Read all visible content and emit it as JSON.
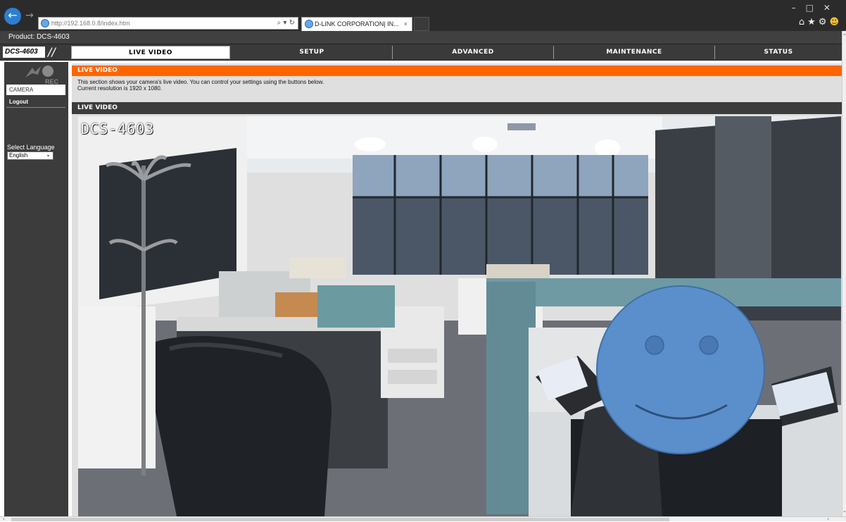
{
  "browser": {
    "address": "http://192.168.0.8/index.htm",
    "tab_title": "D-LINK CORPORATION| IN...",
    "tab_close": "×",
    "win_controls": "–□✕",
    "right_icons": "⌂★⚙"
  },
  "product_bar": "Product: DCS-4603",
  "model_badge": "DCS-4603",
  "nav_tabs": [
    "LIVE VIDEO",
    "SETUP",
    "ADVANCED",
    "MAINTENANCE",
    "STATUS"
  ],
  "sidebar": {
    "rec_label": "REC",
    "camera": "CAMERA",
    "logout": "Logout",
    "language_label": "Select Language",
    "language_value": "English"
  },
  "section": {
    "header": "LIVE VIDEO",
    "desc_line1": "This section shows your camera's live video. You can control your settings using the buttons below.",
    "desc_line2": "Current resolution is 1920 x 1080."
  },
  "video": {
    "header": "LIVE VIDEO",
    "osd_text": "DCS-4603"
  },
  "colors": {
    "accent_orange": "#ff6600",
    "dark_panel": "#3c3c3c",
    "ie_blue": "#2d7fd2"
  }
}
